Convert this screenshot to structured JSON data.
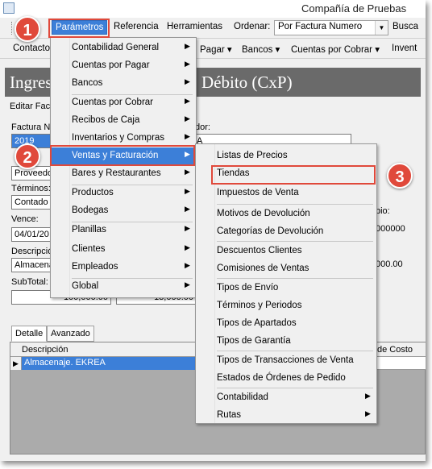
{
  "window": {
    "title": "Compañía de Pruebas"
  },
  "menubar": {
    "items": [
      "Parámetros",
      "Referencia",
      "Herramientas"
    ],
    "ordenar_label": "Ordenar:",
    "ordenar_value": "Por Factura Numero",
    "buscar": "Busca"
  },
  "toolbar2": {
    "items": [
      "Contactos",
      "Pagar ▾",
      "Bancos ▾",
      "Cuentas por Cobrar ▾",
      "Invent"
    ]
  },
  "form": {
    "heading_left": "Ingres",
    "heading_right": "Débito (CxP)",
    "editar": "Editar Factu",
    "factura_label": "Factura N",
    "factura_value": "2019",
    "proveedor_label": "dor:",
    "proveedor_value": "A",
    "prov_left": "Proveedo",
    "terminos_label": "Términos:",
    "terminos_value": "Contado",
    "vence_label": "Vence:",
    "vence_value": "04/01/20",
    "descripcion_label": "Descripció",
    "descripcion_value": "Almacena",
    "subtotal_label": "SubTotal:",
    "subtotal_value": "100,000.00",
    "subtotal2_value": "13,000.00",
    "cambio_label": "bio:",
    "cambio_value": "000000",
    "total_value": "000.00"
  },
  "tabs": [
    "Detalle",
    "Avanzado"
  ],
  "grid": {
    "columns": [
      "Descripción",
      "de Costo"
    ],
    "rows": [
      {
        "descripcion": "Almacenaje. EKREA"
      }
    ]
  },
  "menu_parametros": {
    "items": [
      {
        "label": "Contabilidad General",
        "sub": true
      },
      {
        "label": "Cuentas por Pagar",
        "sub": true
      },
      {
        "label": "Bancos",
        "sub": true
      },
      {
        "label": "Cuentas por Cobrar",
        "sub": true
      },
      {
        "label": "Recibos de Caja",
        "sub": true
      },
      {
        "label": "Inventarios y Compras",
        "sub": true
      },
      {
        "label": "Ventas y Facturación",
        "sub": true
      },
      {
        "label": "Bares y Restaurantes",
        "sub": true
      },
      {
        "label": "Productos",
        "sub": true
      },
      {
        "label": "Bodegas",
        "sub": true
      },
      {
        "label": "Planillas",
        "sub": true
      },
      {
        "label": "Clientes",
        "sub": true
      },
      {
        "label": "Empleados",
        "sub": true
      },
      {
        "label": "Global",
        "sub": true
      }
    ]
  },
  "menu_ventas": {
    "items": [
      {
        "label": "Listas de Precios"
      },
      {
        "label": "Tiendas"
      },
      {
        "label": "Impuestos de Venta"
      },
      {
        "label": "Motivos de Devolución"
      },
      {
        "label": "Categorías de Devolución"
      },
      {
        "label": "Descuentos Clientes"
      },
      {
        "label": "Comisiones de Ventas"
      },
      {
        "label": "Tipos de Envío"
      },
      {
        "label": "Términos y Periodos"
      },
      {
        "label": "Tipos de Apartados"
      },
      {
        "label": "Tipos de Garantía"
      },
      {
        "label": "Tipos de Transacciones de Venta"
      },
      {
        "label": "Estados de Órdenes de Pedido"
      },
      {
        "label": "Contabilidad"
      },
      {
        "label": "Rutas"
      }
    ]
  },
  "badges": [
    "1",
    "2",
    "3"
  ],
  "colors": {
    "accent": "#3c7fd8",
    "callout": "#e0493b",
    "header": "#6a6a6a"
  }
}
